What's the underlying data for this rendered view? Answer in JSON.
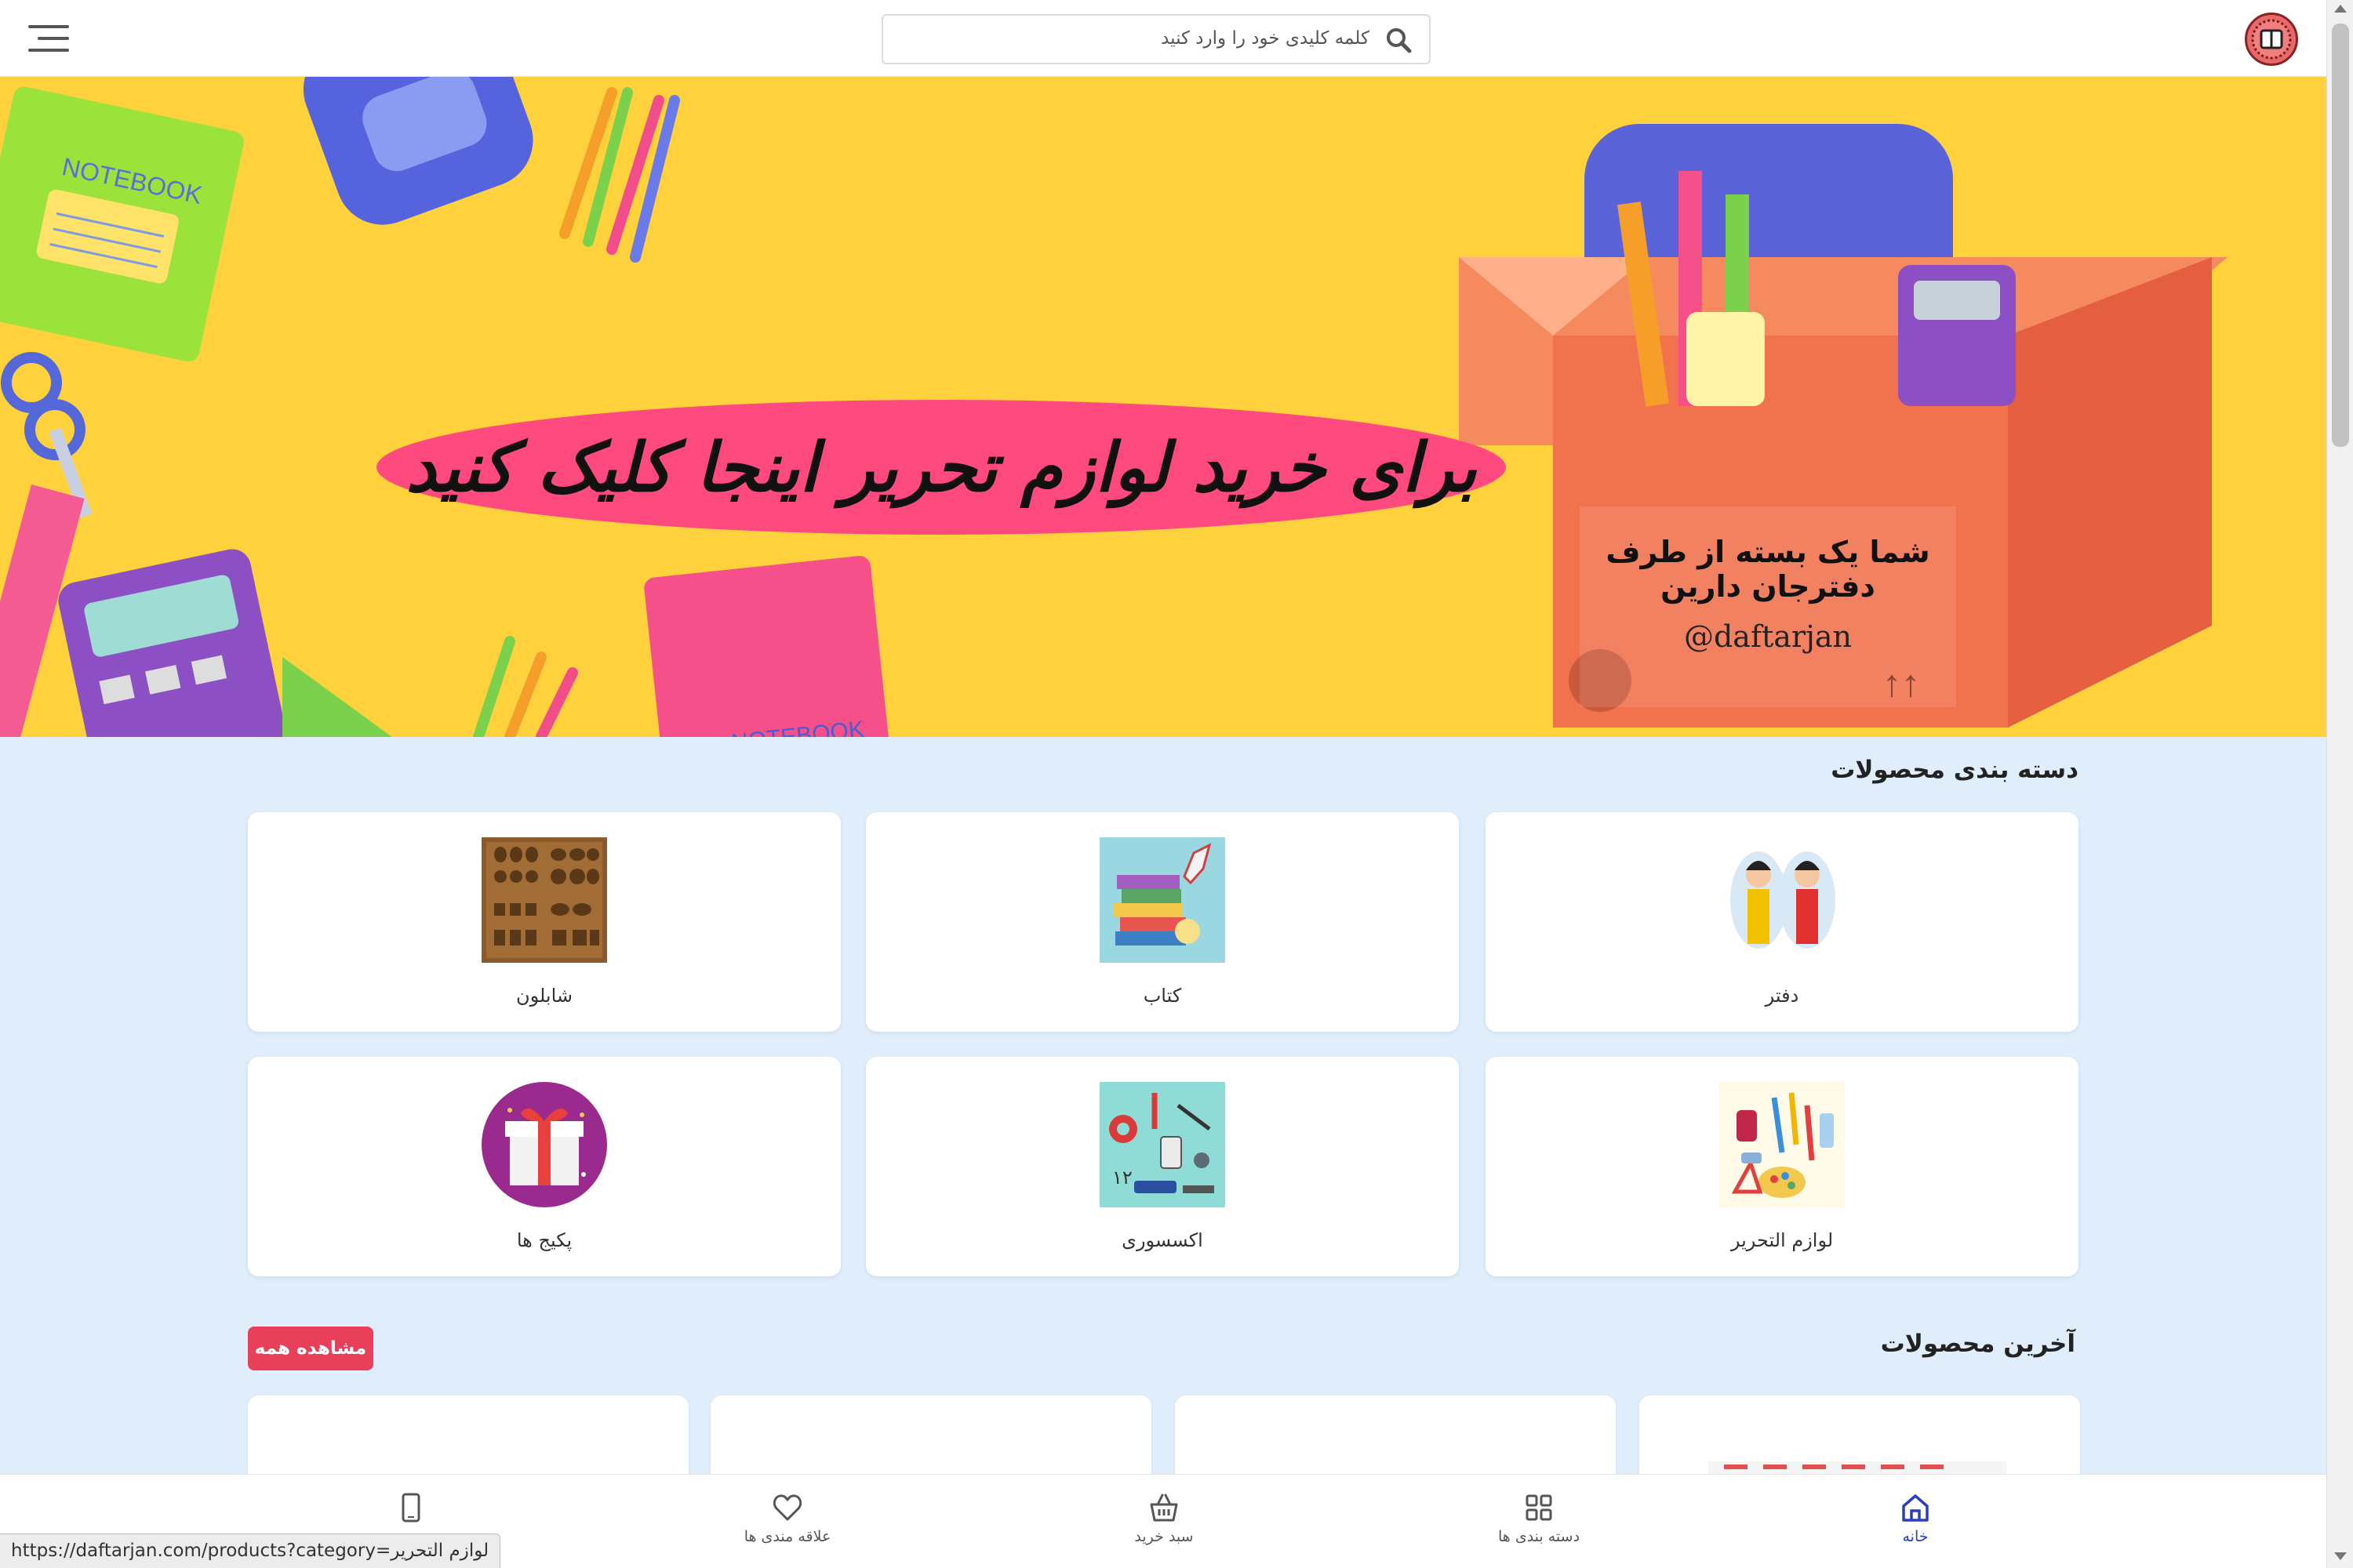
{
  "header": {
    "search_placeholder": "کلمه کلیدی خود را وارد کنید",
    "menu_icon": "hamburger-icon",
    "search_icon": "search-icon",
    "logo_icon": "daftarjan-logo"
  },
  "banner": {
    "cta_text": "برای خرید لوازم تحریر اینجا کلیک کنید",
    "box_line1": "شما یک بسته از طرف دفترجان دارین",
    "box_line2": "@daftarjan",
    "notebook_text": "NOTEBOOK",
    "slides": 2,
    "active_slide": 1
  },
  "categories": {
    "title": "دسته بندی محصولات",
    "items": [
      {
        "label": "دفتر",
        "icon": "notebook-kids-image"
      },
      {
        "label": "کتاب",
        "icon": "books-rocket-image"
      },
      {
        "label": "شابلون",
        "icon": "stencil-image"
      },
      {
        "label": "لوازم التحریر",
        "icon": "stationery-image"
      },
      {
        "label": "اکسسوری",
        "icon": "accessories-image"
      },
      {
        "label": "پکیج ها",
        "icon": "gift-package-image"
      }
    ]
  },
  "latest": {
    "title": "آخرین محصولات",
    "see_all": "مشاهده همه"
  },
  "bottom_nav": {
    "items": [
      {
        "label": "خانه",
        "icon": "home-icon",
        "active": true
      },
      {
        "label": "دسته بندی ها",
        "icon": "grid-icon",
        "active": false
      },
      {
        "label": "سبد خرید",
        "icon": "basket-icon",
        "active": false
      },
      {
        "label": "علاقه مندی ها",
        "icon": "heart-icon",
        "active": false
      },
      {
        "label": "",
        "icon": "phone-icon",
        "active": false
      }
    ]
  },
  "status_url": "https://daftarjan.com/products?category=لوازم التحریر",
  "colors": {
    "banner_bg": "#ffd23d",
    "cta_pink": "#ff4a7f",
    "page_bg": "#e0eefc",
    "see_all_bg": "#e8405a",
    "nav_active": "#2a3fbf"
  }
}
